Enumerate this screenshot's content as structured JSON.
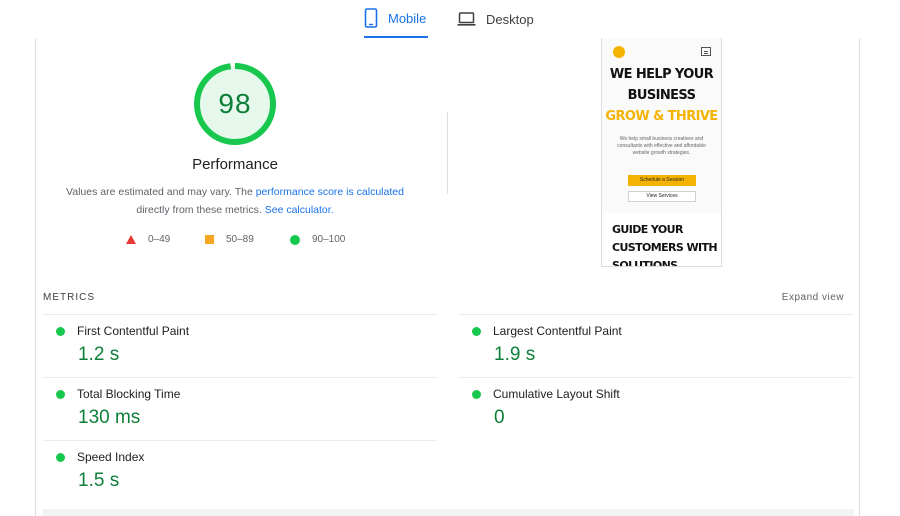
{
  "tabs": {
    "mobile": {
      "label": "Mobile",
      "icon": "smartphone-icon",
      "selected": true
    },
    "desktop": {
      "label": "Desktop",
      "icon": "laptop-icon",
      "selected": false
    }
  },
  "performance": {
    "score": "98",
    "score_fraction": 0.98,
    "title": "Performance",
    "desc_prefix": "Values are estimated and may vary. The ",
    "desc_link1": "performance score is calculated",
    "desc_middle": " directly from these metrics. ",
    "desc_link2": "See calculator.",
    "accent_color": "#18c84e"
  },
  "legend": [
    {
      "label": "0–49",
      "color": "#e53935",
      "icon": "fail-triangle-icon"
    },
    {
      "label": "50–89",
      "color": "#f6a623",
      "icon": "average-square-icon"
    },
    {
      "label": "90–100",
      "color": "#18c84e",
      "icon": "pass-circle-icon"
    }
  ],
  "screenshot": {
    "headline1": "WE HELP YOUR",
    "headline2": "BUSINESS",
    "headline3": "GROW & THRIVE",
    "subtext": "We help small business creatives and consultants with effective and affordable website growth strategies.",
    "button_primary": "Schedule a Session",
    "button_secondary": "View Services",
    "section_heading1": "GUIDE YOUR",
    "section_heading2": "CUSTOMERS WITH",
    "section_heading3": "SOLUTIONS"
  },
  "metrics": {
    "label": "METRICS",
    "expand_label": "Expand view",
    "items": [
      {
        "name": "First Contentful Paint",
        "value": "1.2 s"
      },
      {
        "name": "Largest Contentful Paint",
        "value": "1.9 s"
      },
      {
        "name": "Total Blocking Time",
        "value": "130 ms"
      },
      {
        "name": "Cumulative Layout Shift",
        "value": "0"
      },
      {
        "name": "Speed Index",
        "value": "1.5 s"
      }
    ]
  }
}
